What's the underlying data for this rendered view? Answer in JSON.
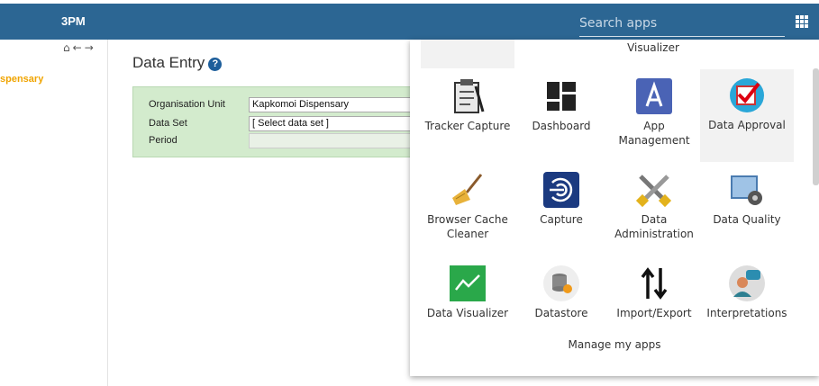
{
  "header": {
    "time": "3PM",
    "search_placeholder": "Search apps"
  },
  "left": {
    "org_unit": "spensary"
  },
  "main": {
    "title": "Data Entry",
    "help_icon": "?",
    "form": {
      "org_unit_label": "Organisation Unit",
      "org_unit_value": "Kapkomoi Dispensary",
      "dataset_label": "Data Set",
      "dataset_value": "[ Select data set ]",
      "period_label": "Period",
      "period_value": ""
    }
  },
  "apps_menu": {
    "partial_label": "Visualizer",
    "apps": [
      {
        "label": "Tracker Capture",
        "icon": "tracker-capture-icon"
      },
      {
        "label": "Dashboard",
        "icon": "dashboard-icon"
      },
      {
        "label": "App Management",
        "icon": "app-management-icon"
      },
      {
        "label": "Data Approval",
        "icon": "data-approval-icon"
      },
      {
        "label": "Browser Cache Cleaner",
        "icon": "browser-cache-cleaner-icon"
      },
      {
        "label": "Capture",
        "icon": "capture-icon"
      },
      {
        "label": "Data Administration",
        "icon": "data-administration-icon"
      },
      {
        "label": "Data Quality",
        "icon": "data-quality-icon"
      },
      {
        "label": "Data Visualizer",
        "icon": "data-visualizer-icon"
      },
      {
        "label": "Datastore",
        "icon": "datastore-icon"
      },
      {
        "label": "Import/Export",
        "icon": "import-export-icon"
      },
      {
        "label": "Interpretations",
        "icon": "interpretations-icon"
      }
    ],
    "manage_label": "Manage my apps"
  },
  "colors": {
    "header": "#2c6693",
    "form_bg": "#d3ebcd",
    "org_highlight": "#f0a400"
  }
}
